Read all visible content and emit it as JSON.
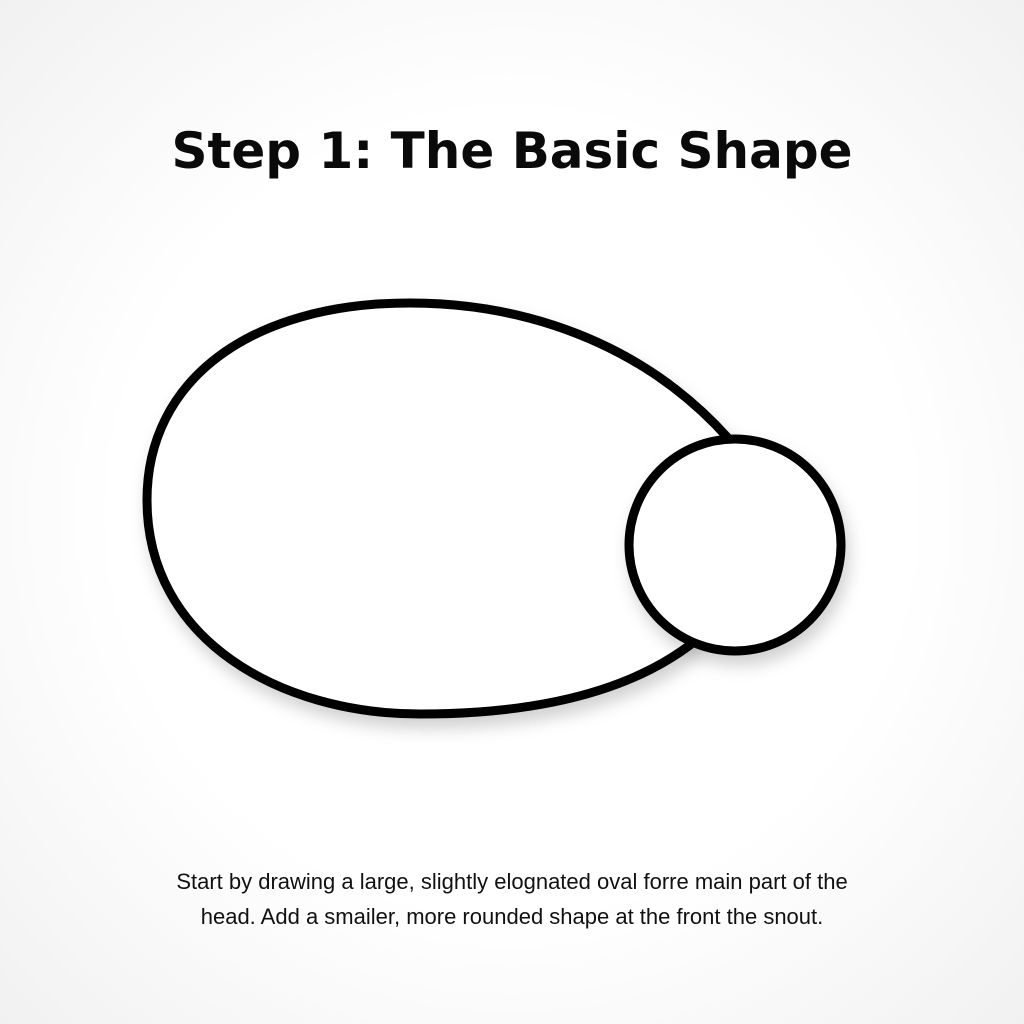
{
  "title": "Step 1: The Basic Shape",
  "caption": {
    "line1": "Start by drawing a large, slightly elognated oval forre main part of the",
    "line2": "head. Add a smailer, more rounded shape at the front the snout."
  },
  "colors": {
    "stroke": "#000000",
    "fill": "#ffffff"
  }
}
